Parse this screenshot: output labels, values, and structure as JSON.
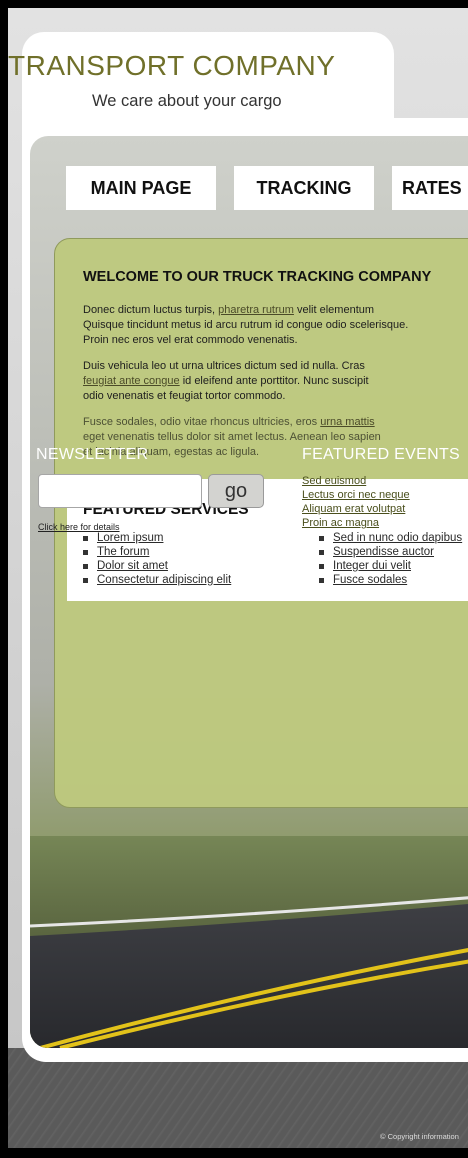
{
  "header": {
    "title": "TRANSPORT COMPANY",
    "subtitle": "We care about your cargo"
  },
  "nav": {
    "items": [
      {
        "label": "MAIN PAGE"
      },
      {
        "label": "TRACKING"
      },
      {
        "label": "RATES"
      }
    ]
  },
  "welcome": {
    "title": "WELCOME TO OUR TRUCK TRACKING COMPANY",
    "p1": {
      "a": "Donec dictum luctus turpis, ",
      "link": "pharetra rutrum",
      "b": " velit elementum",
      "line2": "Quisque tincidunt metus id arcu rutrum id congue odio scelerisque.",
      "line3": "Proin nec eros vel erat commodo venenatis."
    },
    "p2": {
      "line1": "Duis vehicula leo ut urna ultrices dictum sed id nulla. Cras",
      "link": "feugiat ante congue",
      "b": " id eleifend ante porttitor. Nunc suscipit",
      "line3": "odio venenatis et feugiat tortor commodo."
    },
    "p3": {
      "a": "Fusce sodales, odio vitae rhoncus ultricies, eros ",
      "link": "urna mattis",
      "line2": "eget venenatis tellus dolor sit amet lectus. Aenean leo sapien",
      "line3": "et lacinia aliquam, egestas ac ligula."
    }
  },
  "services": {
    "title": "FEATURED SERVICES",
    "col1": [
      "Lorem ipsum",
      "The forum",
      "Dolor sit amet",
      "Consectetur adipiscing elit"
    ],
    "col2": [
      "Sed in nunc odio dapibus",
      "Suspendisse auctor",
      "Integer dui velit",
      "Fusce sodales"
    ]
  },
  "newsletter": {
    "title": "NEWSLETTER",
    "input_value": "",
    "go_label": "go",
    "details_link": "Click here for details"
  },
  "events": {
    "title": "FEATURED EVENTS",
    "items": [
      "Sed euismod",
      "Lectus orci nec neque",
      "Aliquam erat volutpat",
      "Proin ac magna"
    ]
  },
  "footer": {
    "copyright": "© Copyright information"
  }
}
